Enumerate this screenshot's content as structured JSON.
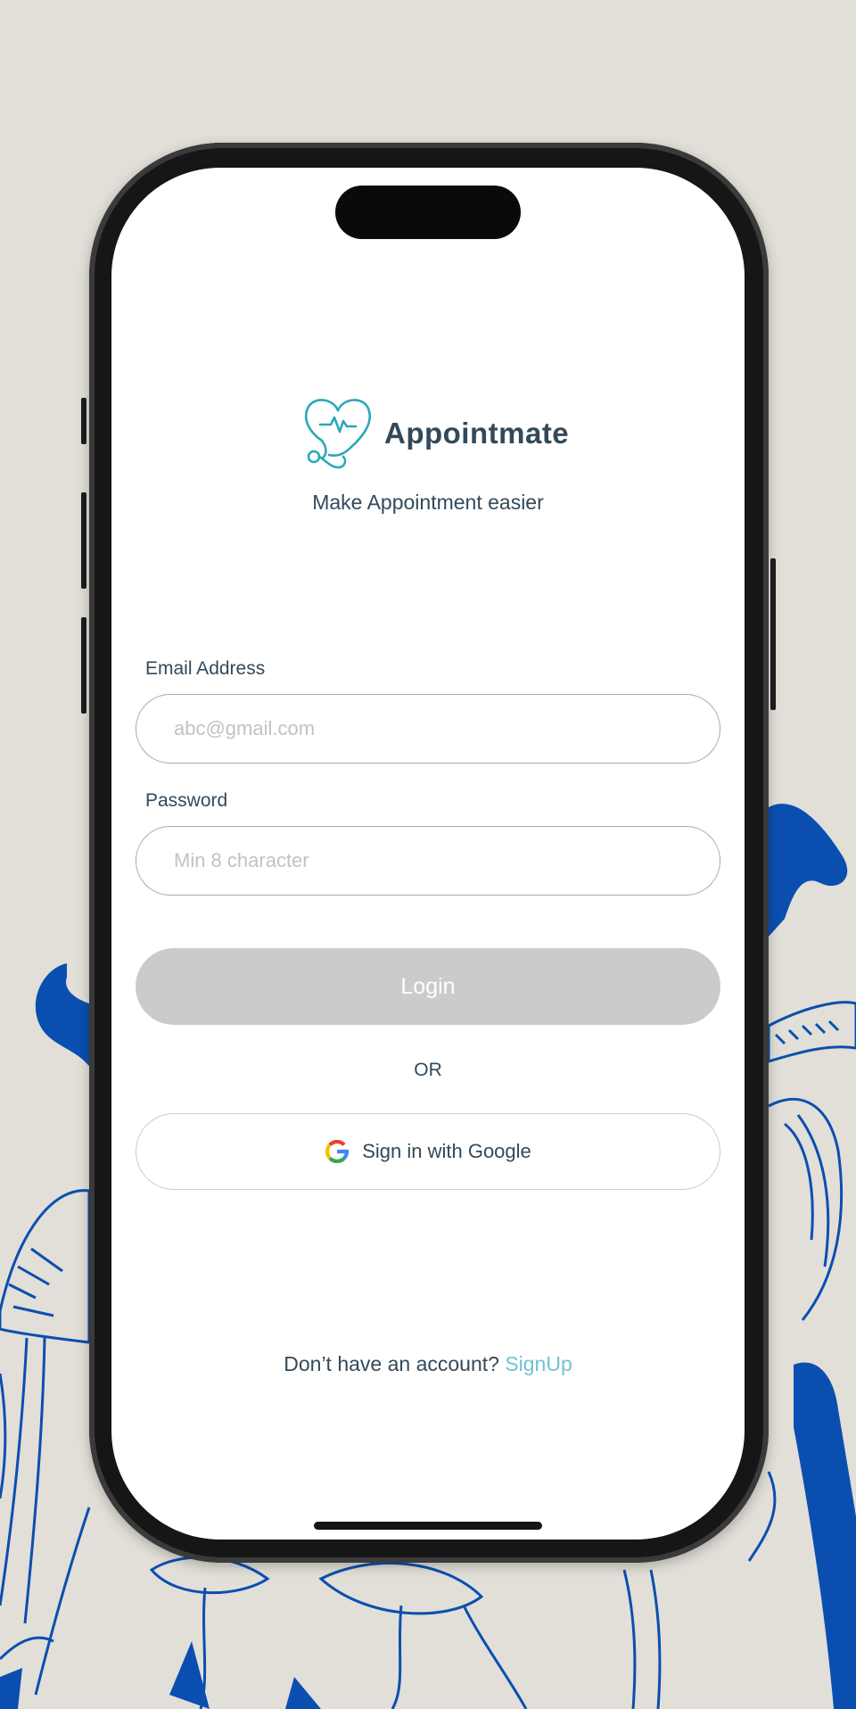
{
  "app": {
    "name": "Appointmate",
    "tagline": "Make Appointment easier"
  },
  "form": {
    "email_label": "Email Address",
    "email_placeholder": "abc@gmail.com",
    "email_value": "",
    "password_label": "Password",
    "password_placeholder": "Min 8 character",
    "password_value": ""
  },
  "actions": {
    "login_label": "Login",
    "or_text": "OR",
    "google_label": "Sign in with Google"
  },
  "footer": {
    "prompt": "Don’t have an account?",
    "signup_label": "SignUp"
  },
  "colors": {
    "primary_text": "#33495a",
    "accent": "#72c2d2",
    "logo_teal": "#2aa8ba",
    "login_disabled": "#cbcbcb",
    "background": "#e2dfd8",
    "illustration_blue": "#0a4fb0"
  },
  "icons": {
    "logo": "heart-stethoscope-icon",
    "google": "google-g-icon"
  }
}
